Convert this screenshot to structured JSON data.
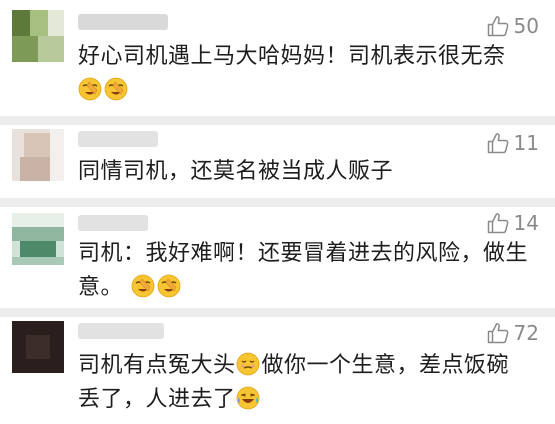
{
  "comments": [
    {
      "likes": "50",
      "text": "好心司机遇上马大哈妈妈！司机表示很无奈",
      "emojis": [
        "facepalm-emoji",
        "facepalm-emoji"
      ]
    },
    {
      "likes": "11",
      "text": "同情司机，还莫名被当成人贩子",
      "emojis": []
    },
    {
      "likes": "14",
      "text_line1": "司机：我好难啊！还要冒着进去的风险，做生",
      "text_line2": "意。",
      "emojis": [
        "facepalm-emoji",
        "facepalm-emoji"
      ]
    },
    {
      "likes": "72",
      "text_part1": "司机有点冤大头",
      "text_part2": "做你一个生意，差点饭碗",
      "text_line2": "丢了，人进去了",
      "emojis": [
        "smirk-emoji",
        "laugh-cry-emoji"
      ]
    }
  ],
  "colors": {
    "separator": "#ededed",
    "like_gray": "#8a8a8a",
    "text": "#1e1e1e"
  }
}
